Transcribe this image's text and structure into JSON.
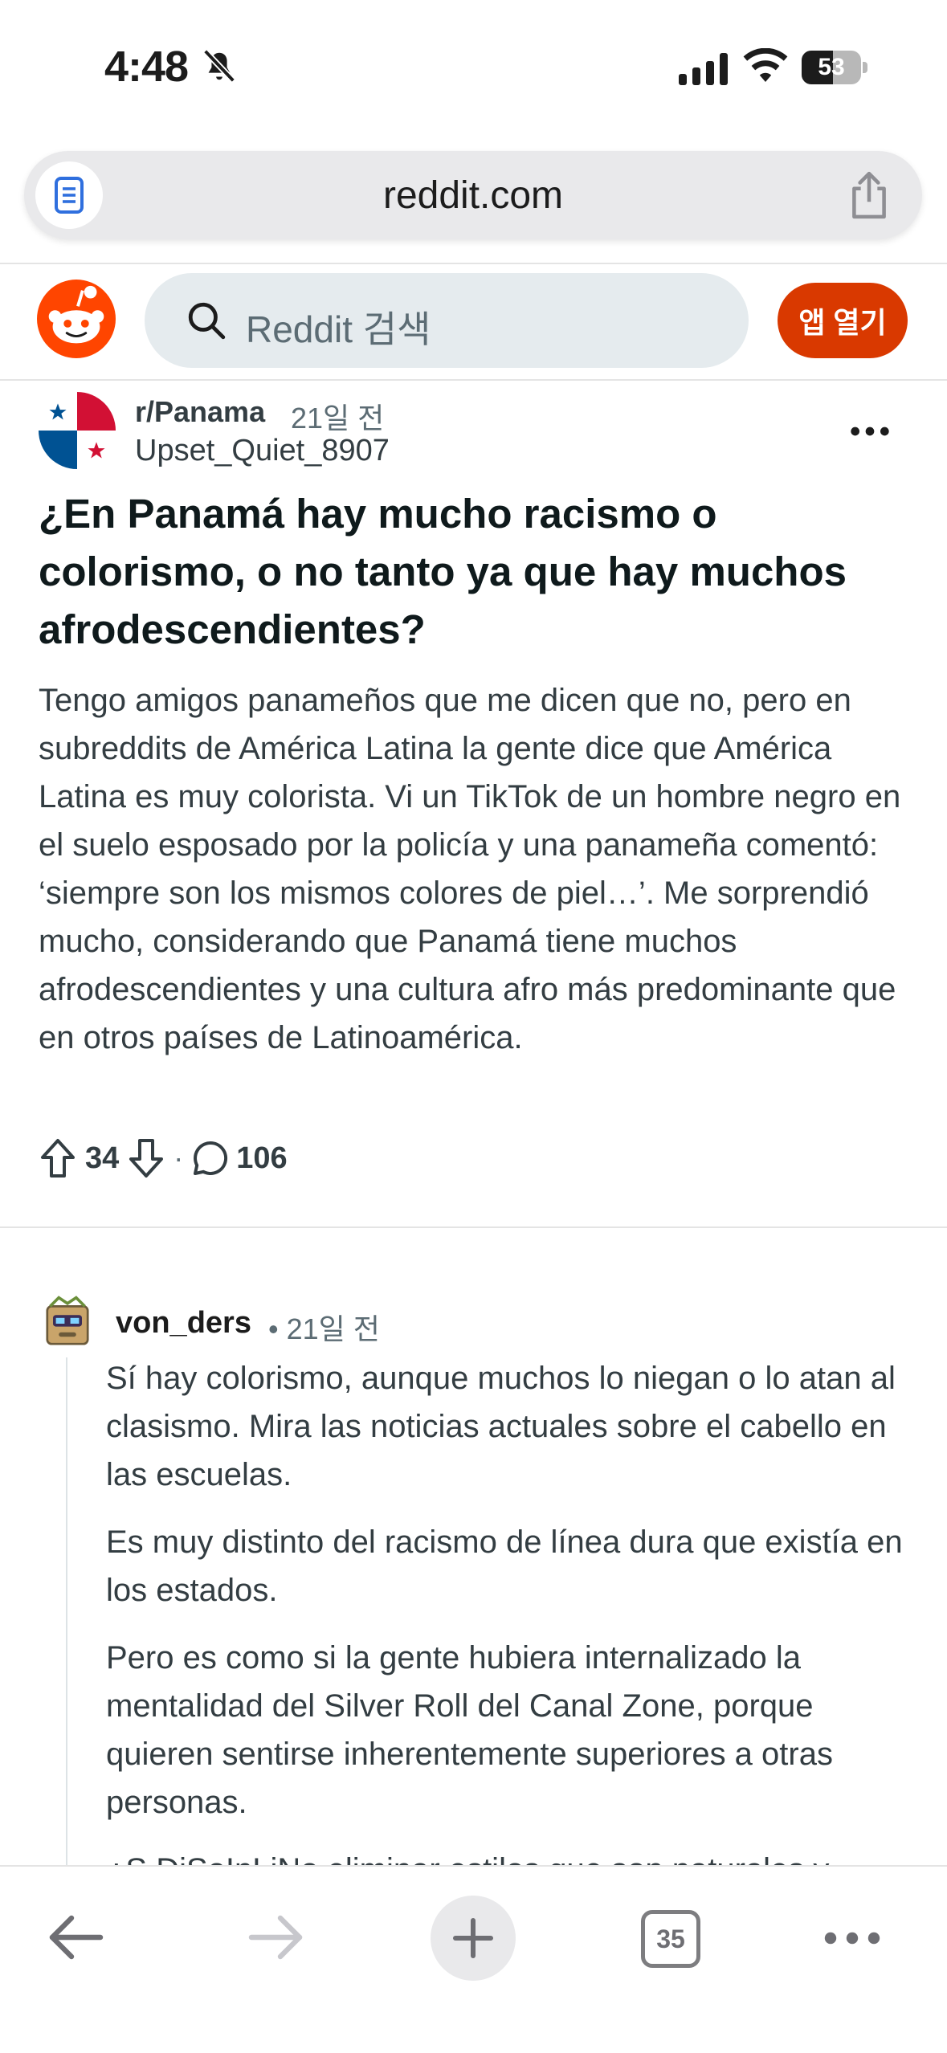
{
  "status_bar": {
    "time": "4:48",
    "battery_level": "53",
    "battery_fraction": 0.53,
    "icons": [
      "bell-slash-icon",
      "cellular-signal-icon",
      "wifi-icon",
      "battery-icon"
    ]
  },
  "browser": {
    "url": "reddit.com",
    "icons": [
      "reader-icon",
      "share-icon"
    ],
    "tab_count": "35",
    "toolbar_icons": [
      "back-arrow-icon",
      "forward-arrow-icon",
      "plus-icon",
      "tabs-icon",
      "more-dots-icon"
    ]
  },
  "reddit_header": {
    "search_placeholder": "Reddit 검색",
    "open_app_label": "앱 열기",
    "colors": {
      "accent": "#d93900",
      "logo": "#ff4500",
      "search_bg": "#e5ebee"
    }
  },
  "post": {
    "subreddit": "r/Panama",
    "time": "21일 전",
    "author": "Upset_Quiet_8907",
    "title": "¿En Panamá hay mucho racismo o colorismo, o no tanto ya que hay muchos afrodescendientes?",
    "body": "Tengo amigos panameños que me dicen que no, pero en subreddits de América Latina la gente dice que América Latina es muy colorista. Vi un TikTok de un hombre negro en el suelo esposado por la policía y una panameña comentó: ‘siempre son los mismos colores de piel…’. Me sorprendió mucho, considerando que Panamá tiene muchos afrodescendientes y una cultura afro más predominante que en otros países de Latinoamérica.",
    "upvotes": "34",
    "separator": "·",
    "comments": "106"
  },
  "comment": {
    "author": "von_ders",
    "time": "• 21일 전",
    "paragraphs": [
      "Sí hay colorismo, aunque muchos lo niegan o lo atan al clasismo. Mira las noticias actuales sobre el cabello en las escuelas.",
      "Es muy distinto del racismo de línea dura que existía en los estados.",
      "Pero es como si la gente hubiera internalizado la mentalidad del Silver Roll del Canal Zone, porque quieren sentirse inherentemente superiores a otras personas."
    ],
    "cut_paragraph": "¿S DiSoInLiNo eliminar estilos que son naturales y"
  }
}
